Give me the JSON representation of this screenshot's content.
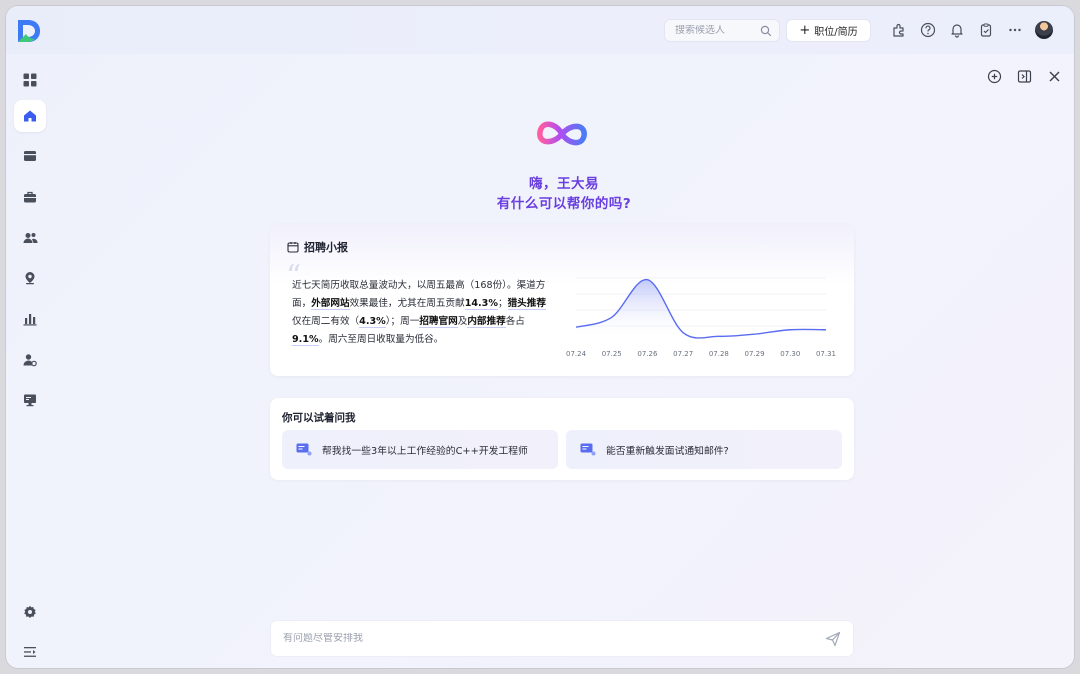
{
  "header": {
    "search": {
      "placeholder": "搜索候选人"
    },
    "new_button_label": "职位/简历"
  },
  "greeting": {
    "line1": "嗨，王大易",
    "line2": "有什么可以帮你的吗?"
  },
  "report": {
    "title": "招聘小报",
    "text": {
      "p1": "近七天简历收取总量波动大，以周五最高（168份）。渠道方面，",
      "s1": "外部网站",
      "p2": "效果最佳，尤其在周五贡献",
      "s2": "14.3%",
      "p3": "；",
      "s3": "猎头推荐",
      "p4": "仅在周二有效（",
      "s4": "4.3%",
      "p5": "）；周一",
      "s5": "招聘官网",
      "p6": "及",
      "s6": "内部推荐",
      "p7": "各占",
      "s7": "9.1%",
      "p8": "。周六至周日收取量为低谷。"
    }
  },
  "chart_data": {
    "type": "area",
    "x": [
      "07.24",
      "07.25",
      "07.26",
      "07.27",
      "07.28",
      "07.29",
      "07.30",
      "07.31"
    ],
    "values": [
      35,
      62,
      165,
      20,
      10,
      16,
      28,
      28
    ],
    "ylim": [
      0,
      175
    ],
    "grid": true,
    "line_color": "#5a6cf0"
  },
  "suggestions": {
    "title": "你可以试着问我",
    "items": [
      {
        "label": "帮我找一些3年以上工作经验的C++开发工程师"
      },
      {
        "label": "能否重新触发面试通知邮件?"
      }
    ]
  },
  "chat": {
    "placeholder": "有问题尽管安排我"
  },
  "colors": {
    "accent": "#6a3fe0",
    "brand_blue": "#3d7bf5",
    "brand_green": "#3ec97a",
    "nav_active": "#3a5cf0"
  },
  "icons": {
    "sidebar": [
      "grid-icon",
      "home-icon",
      "inbox-icon",
      "briefcase-icon",
      "users-icon",
      "location-icon",
      "bar-chart-icon",
      "user-settings-icon",
      "monitor-icon",
      "gear-icon",
      "collapse-menu-icon"
    ],
    "topbar": [
      "search-icon",
      "plugin-icon",
      "help-icon",
      "bell-icon",
      "clipboard-icon",
      "more-icon"
    ]
  }
}
